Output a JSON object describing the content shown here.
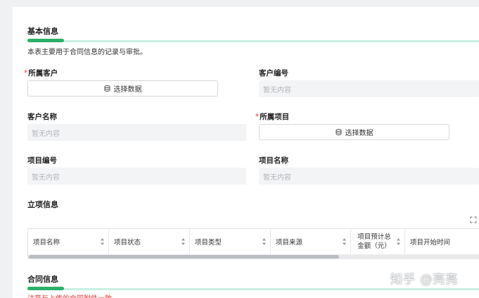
{
  "basic": {
    "title": "基本信息",
    "desc": "本表主要用于合同信息的记录与审批。"
  },
  "fields": {
    "customer": {
      "label": "所属客户",
      "button": "选择数据",
      "required": "*"
    },
    "customer_no": {
      "label": "客户编号",
      "value": "暂无内容"
    },
    "customer_name": {
      "label": "客户名称",
      "value": "暂无内容"
    },
    "project": {
      "label": "所属项目",
      "button": "选择数据",
      "required": "*"
    },
    "project_no": {
      "label": "项目编号",
      "value": "暂无内容"
    },
    "project_name": {
      "label": "项目名称",
      "value": "暂无内容"
    }
  },
  "approval": {
    "title": "立项信息",
    "columns": [
      "项目名称",
      "项目状态",
      "项目类型",
      "项目来源",
      "项目预计总",
      "金额（元）",
      "项目开始时间"
    ]
  },
  "contract": {
    "title": "合同信息",
    "warning": "注意与上传的合同附件一致"
  },
  "watermark": "知乎 @亮亮",
  "colors": {
    "accent": "#2bb06a",
    "required": "#e53935"
  }
}
